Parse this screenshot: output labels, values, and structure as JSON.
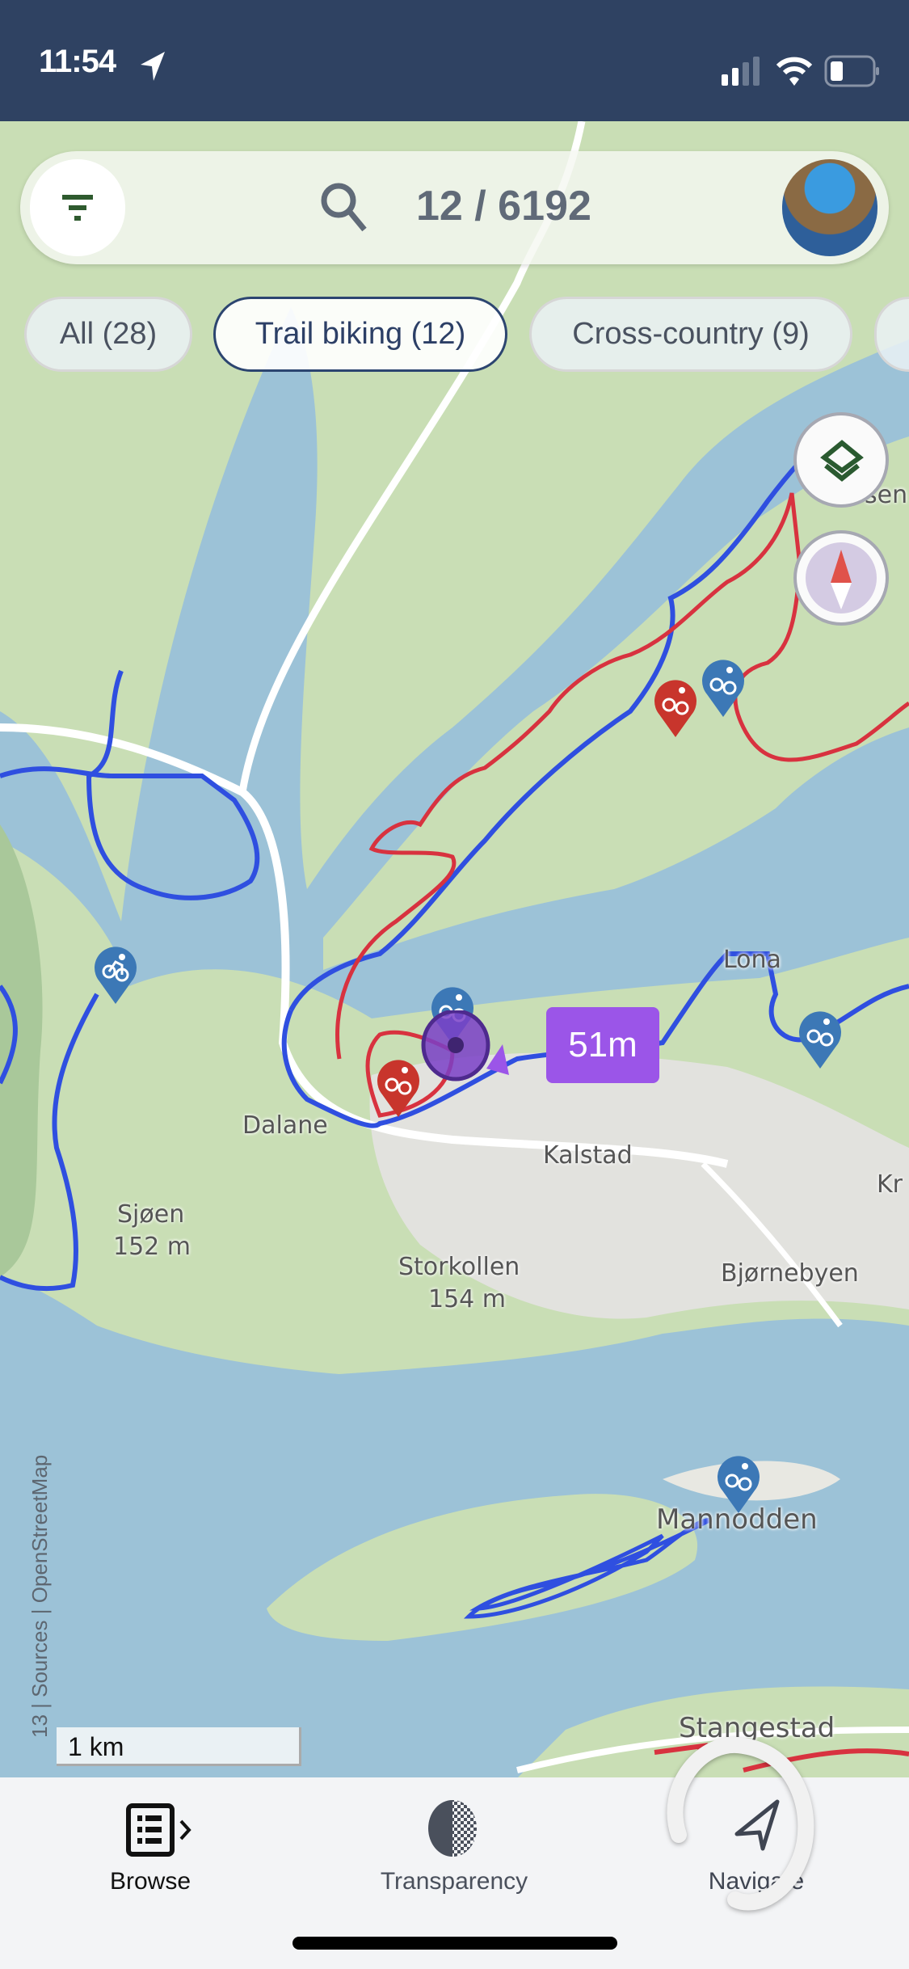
{
  "status_bar": {
    "time": "11:54",
    "location_icon": "location-arrow-icon",
    "signal": "2 of 4 bars",
    "wifi": "wifi-icon",
    "battery_level": 0.25
  },
  "search": {
    "count": "12 / 6192",
    "filter_icon": "filter-icon",
    "search_icon": "search-icon",
    "avatar": "user-avatar"
  },
  "chips": [
    {
      "label": "All (28)",
      "selected": false
    },
    {
      "label": "Trail biking (12)",
      "selected": true
    },
    {
      "label": "Cross-country (9)",
      "selected": false
    }
  ],
  "map": {
    "labels": {
      "lona": "Lona",
      "dalane": "Dalane",
      "kalstad": "Kalstad",
      "sjaen": "Sjøen",
      "sjaen_elev": "152 m",
      "storkollen": "Storkollen",
      "storkollen_elev": "154 m",
      "bjornebyen": "Bjørnebyen",
      "mannodden": "Mannodden",
      "stadestad": "Stangestad",
      "kr": "Kr",
      "sen": "sen"
    },
    "distance_label": "51m",
    "scale": "1 km",
    "attribution": "13 | Sources | OpenStreetMap",
    "colors": {
      "water": "#9cc2d7",
      "land": "#c9deb5",
      "urban": "#e2e2de",
      "route_blue": "#2f4fe0",
      "route_red": "#d8323f",
      "pin_blue": "#3c78b6",
      "pin_red": "#c8352c",
      "position": "#7a3fc8"
    }
  },
  "map_controls": {
    "layers_icon": "layers-icon",
    "compass_icon": "compass-icon"
  },
  "bottom_nav": [
    {
      "label": "Browse",
      "icon": "list-icon"
    },
    {
      "label": "Transparency",
      "icon": "transparency-icon"
    },
    {
      "label": "Navigate",
      "icon": "navigate-arrow-icon"
    }
  ]
}
